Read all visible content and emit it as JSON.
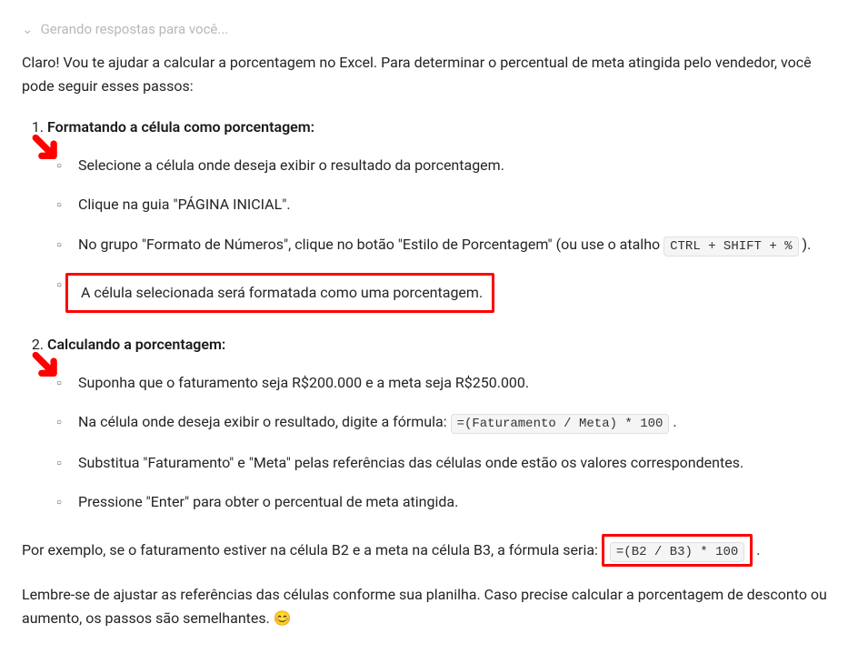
{
  "status": "Gerando respostas para você...",
  "intro": "Claro! Vou te ajudar a calcular a porcentagem no Excel. Para determinar o percentual de meta atingida pelo vendedor, você pode seguir esses passos:",
  "section1": {
    "title": "Formatando a célula como porcentagem:",
    "items": {
      "a": "Selecione a célula onde deseja exibir o resultado da porcentagem.",
      "b": "Clique na guia \"PÁGINA INICIAL\".",
      "c_prefix": "No grupo \"Formato de Números\", clique no botão \"Estilo de Porcentagem\" (ou use o atalho ",
      "c_code": "CTRL + SHIFT + %",
      "c_suffix": ").",
      "d": "A célula selecionada será formatada como uma porcentagem."
    }
  },
  "section2": {
    "title": "Calculando a porcentagem:",
    "items": {
      "a": "Suponha que o faturamento seja R$200.000 e a meta seja R$250.000.",
      "b_prefix": "Na célula onde deseja exibir o resultado, digite a fórmula: ",
      "b_code": "=(Faturamento / Meta) * 100",
      "b_suffix": ".",
      "c": "Substitua \"Faturamento\" e \"Meta\" pelas referências das células onde estão os valores correspondentes.",
      "d": "Pressione \"Enter\" para obter o percentual de meta atingida."
    }
  },
  "example": {
    "prefix": "Por exemplo, se o faturamento estiver na célula B2 e a meta na célula B3, a fórmula seria: ",
    "code": "=(B2 / B3) * 100",
    "suffix": "."
  },
  "closing": "Lembre-se de ajustar as referências das células conforme sua planilha. Caso precise calcular a porcentagem de desconto ou aumento, os passos são semelhantes. ",
  "emoji": "😊"
}
